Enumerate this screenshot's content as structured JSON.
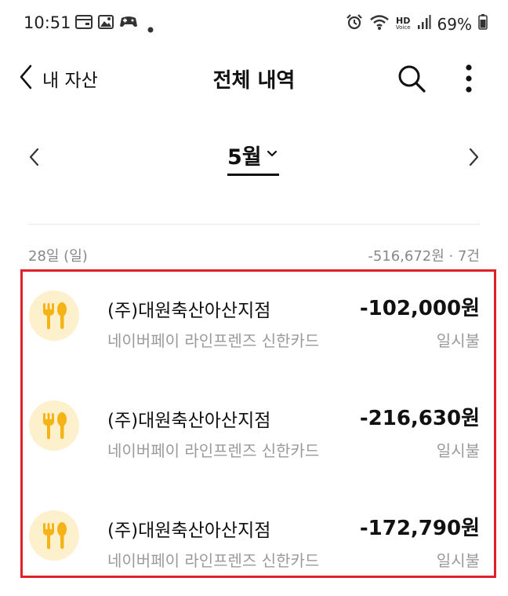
{
  "status_bar": {
    "time": "10:51",
    "battery": "69%",
    "hd_label": "HD",
    "voice_label": "Voice"
  },
  "header": {
    "back_label": "내 자산",
    "title": "전체 내역"
  },
  "month_nav": {
    "current_month": "5월"
  },
  "day_group": {
    "date_label": "28일 (일)",
    "summary": "-516,672원 · 7건"
  },
  "transactions": [
    {
      "merchant": "(주)대원축산아산지점",
      "card": "네이버페이 라인프렌즈 신한카드",
      "amount": "-102,000원",
      "installment": "일시불",
      "category_icon": "fork-spoon-icon"
    },
    {
      "merchant": "(주)대원축산아산지점",
      "card": "네이버페이 라인프렌즈 신한카드",
      "amount": "-216,630원",
      "installment": "일시불",
      "category_icon": "fork-spoon-icon"
    },
    {
      "merchant": "(주)대원축산아산지점",
      "card": "네이버페이 라인프렌즈 신한카드",
      "amount": "-172,790원",
      "installment": "일시불",
      "category_icon": "fork-spoon-icon"
    }
  ],
  "colors": {
    "highlight_border": "#e0202a",
    "icon_background": "#fdf0cc",
    "icon_foreground": "#f5b316"
  }
}
